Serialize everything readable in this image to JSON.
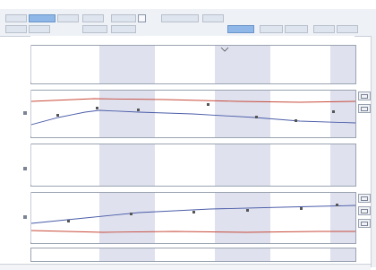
{
  "window": {
    "title": ""
  },
  "toolbar": {
    "buttons": [
      {
        "name": "tool-button-1",
        "active": false
      },
      {
        "name": "tool-button-2",
        "active": true
      },
      {
        "name": "tool-button-3",
        "active": false
      },
      {
        "name": "tool-button-4",
        "active": false
      },
      {
        "name": "tool-button-5",
        "active": false
      },
      {
        "name": "tool-button-6",
        "active": false
      },
      {
        "name": "tool-button-7",
        "active": true
      },
      {
        "name": "tool-button-8",
        "active": false
      }
    ]
  },
  "icons": {
    "scale": "zoom-icon",
    "marker": "square-marker-icon"
  },
  "colors": {
    "band": "#dfe1ee",
    "blue_series": "#4a5ca8",
    "red_series": "#c84a3a",
    "panel_border": "#9aa3b1"
  }
}
